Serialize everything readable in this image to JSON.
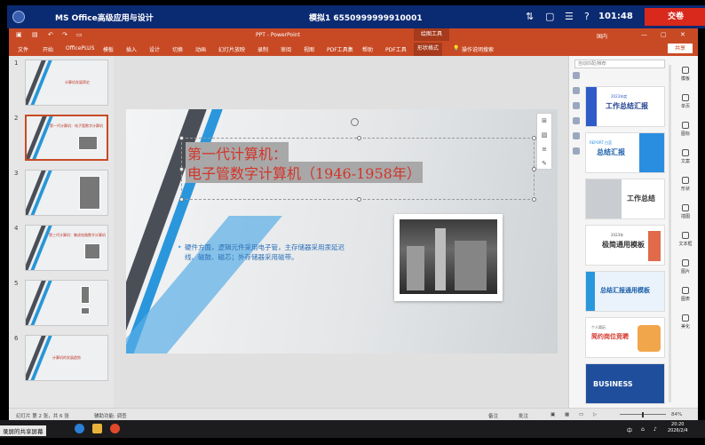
{
  "exam": {
    "title": "MS Office高级应用与设计",
    "ticket": "模拟1  6550999999910001",
    "timer": "101:48",
    "submit": "交卷",
    "help_icon": "?"
  },
  "ppt": {
    "doc_title": "PPT - PowerPoint",
    "context_tab": "绘图工具",
    "user": "国内",
    "share": "共享",
    "tabs": [
      "文件",
      "开始",
      "OfficePLUS",
      "模板",
      "插入",
      "设计",
      "切换",
      "动画",
      "幻灯片放映",
      "录制",
      "审阅",
      "视图",
      "PDF工具集",
      "帮助",
      "PDF工具",
      "形状格式",
      "操作说明搜索"
    ],
    "active_tab_index": 15,
    "thumbnails": [
      {
        "num": "1",
        "text": "计算机发展简史"
      },
      {
        "num": "2",
        "text": "第一代计算机：电子管数字计算机"
      },
      {
        "num": "3",
        "text": ""
      },
      {
        "num": "4",
        "text": "第三代计算机：集成电路数字计算机"
      },
      {
        "num": "5",
        "text": ""
      },
      {
        "num": "6",
        "text": "计算机的发展趋势"
      }
    ],
    "selected_thumb": 1,
    "slide": {
      "title_line1": "第一代计算机：",
      "title_line2": "电子管数字计算机（1946-1958年）",
      "body": "硬件方面，逻辑元件采用电子管，主存储器采用汞延迟线、磁鼓、磁芯；外存储器采用磁带。"
    },
    "pane": {
      "search_placeholder": "自动匹配/推荐",
      "templates": [
        {
          "title": "工作总结汇报",
          "sub": "2023年度"
        },
        {
          "title": "总结汇报",
          "sub": "REPORT  白蓝"
        },
        {
          "title": "工作总结",
          "sub": ""
        },
        {
          "title": "极简通用模板",
          "sub": "2023年"
        },
        {
          "title": "总结汇报通用模板",
          "sub": ""
        },
        {
          "title": "简约岗位竞聘",
          "sub": "个人简历"
        },
        {
          "title": "BUSINESS",
          "sub": ""
        }
      ]
    },
    "tools": [
      "模板",
      "单页",
      "图标",
      "文案",
      "形状",
      "插图",
      "文本框",
      "图片",
      "图表",
      "美化"
    ],
    "status": {
      "slide_info": "幻灯片 第 2 张，共 6 张",
      "accessibility": "辅助功能: 调查",
      "notes": "备注",
      "comments": "批注",
      "zoom": "84%"
    }
  },
  "taskbar": {
    "share_label": "录屏的共享屏幕",
    "ime": "中",
    "time": "20:20",
    "date": "2026/2/4"
  }
}
